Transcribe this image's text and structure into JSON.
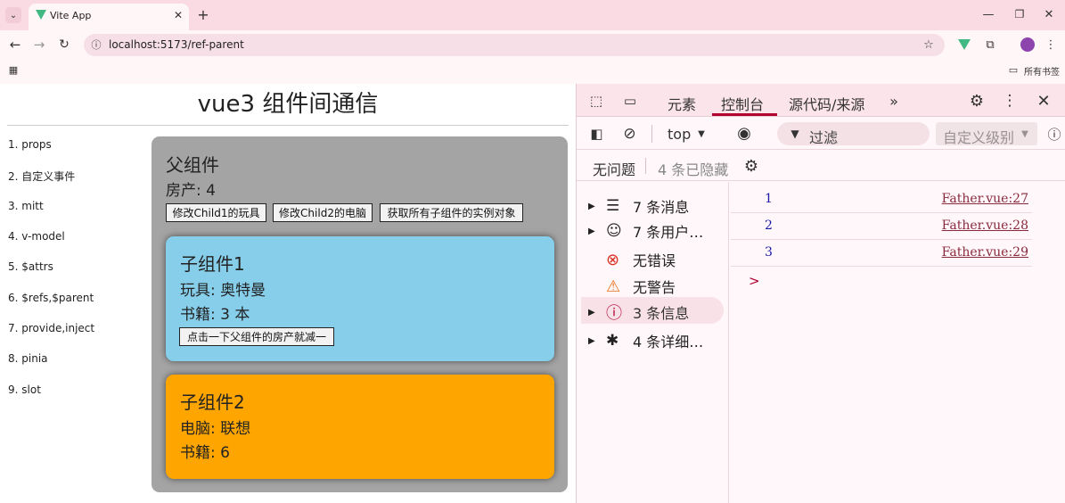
{
  "browser": {
    "tab_title": "Vite App",
    "url": "localhost:5173/ref-parent",
    "bookmarks_label": "所有书签"
  },
  "page": {
    "title": "vue3 组件间通信",
    "nav": [
      "1. props",
      "2. 自定义事件",
      "3. mitt",
      "4. v-model",
      "5. $attrs",
      "6. $refs,$parent",
      "7. provide,inject",
      "8. pinia",
      "9. slot"
    ],
    "parent": {
      "title": "父组件",
      "house": "房产: 4",
      "buttons": [
        "修改Child1的玩具",
        "修改Child2的电脑",
        "获取所有子组件的实例对象"
      ]
    },
    "child1": {
      "title": "子组件1",
      "toy": "玩具: 奥特曼",
      "book": "书籍: 3 本",
      "button": "点击一下父组件的房产就减一"
    },
    "child2": {
      "title": "子组件2",
      "computer": "电脑: 联想",
      "book": "书籍: 6"
    }
  },
  "devtools": {
    "tabs": [
      "元素",
      "控制台",
      "源代码/来源"
    ],
    "context": "top",
    "filter": "过滤",
    "levels": "自定义级别",
    "no_issues": "无问题",
    "hidden": "4 条已隐藏",
    "sidebar": [
      "7 条消息",
      "7 条用户…",
      "无错误",
      "无警告",
      "3 条信息",
      "4 条详细…"
    ],
    "logs": [
      {
        "value": "1",
        "source": "Father.vue:27"
      },
      {
        "value": "2",
        "source": "Father.vue:28"
      },
      {
        "value": "3",
        "source": "Father.vue:29"
      }
    ],
    "prompt": ">"
  },
  "colors": {
    "accent": "#b30033",
    "child1": "#87ceeb",
    "child2": "#ffa500",
    "parent": "#a4a4a4",
    "log_number": "#1a1aa6"
  }
}
